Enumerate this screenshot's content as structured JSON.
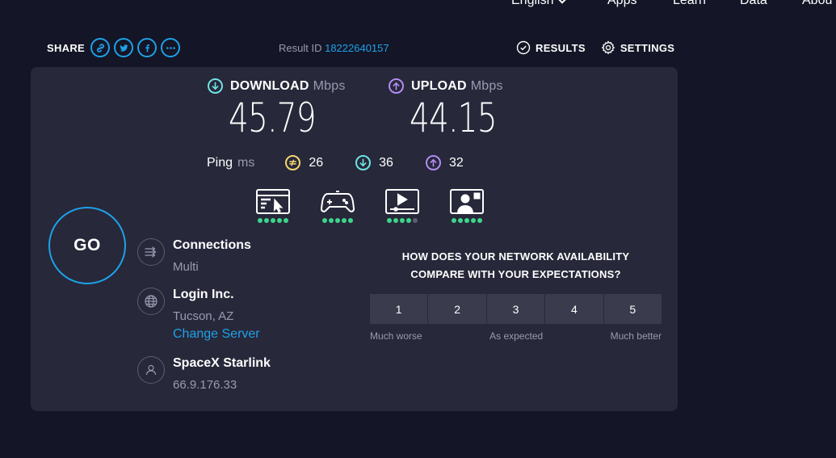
{
  "nav": {
    "english": "English",
    "apps": "Apps",
    "learn": "Learn",
    "data": "Data",
    "about": "Abou"
  },
  "share": {
    "label": "SHARE",
    "icons": [
      "link-icon",
      "twitter-icon",
      "facebook-icon",
      "more-icon"
    ]
  },
  "result": {
    "label": "Result ID",
    "id": "18222640157"
  },
  "actions": {
    "results": "RESULTS",
    "settings": "SETTINGS"
  },
  "download": {
    "label": "DOWNLOAD",
    "unit": "Mbps",
    "value": "45.79",
    "color": "#6fe3e3"
  },
  "upload": {
    "label": "UPLOAD",
    "unit": "Mbps",
    "value": "44.15",
    "color": "#b28cf2"
  },
  "ping": {
    "label": "Ping",
    "unit": "ms",
    "idle": "26",
    "download": "36",
    "upload": "32",
    "idle_color": "#f5d76e",
    "download_color": "#6fe3e3",
    "upload_color": "#b28cf2"
  },
  "apps": [
    {
      "name": "web-browsing",
      "rating": 5
    },
    {
      "name": "gaming",
      "rating": 5
    },
    {
      "name": "video-streaming",
      "rating": 4
    },
    {
      "name": "video-chat",
      "rating": 5
    }
  ],
  "go": {
    "label": "GO"
  },
  "connections": {
    "title": "Connections",
    "value": "Multi"
  },
  "server": {
    "title": "Login Inc.",
    "location": "Tucson, AZ",
    "change": "Change Server"
  },
  "isp": {
    "title": "SpaceX Starlink",
    "ip": "66.9.176.33"
  },
  "survey": {
    "question_line1": "HOW DOES YOUR NETWORK AVAILABILITY",
    "question_line2": "COMPARE WITH YOUR EXPECTATIONS?",
    "options": [
      "1",
      "2",
      "3",
      "4",
      "5"
    ],
    "low": "Much worse",
    "mid": "As expected",
    "high": "Much better"
  },
  "colors": {
    "accent": "#1ea1e8",
    "good": "#3dd68c",
    "card": "#27283a",
    "background": "#141526"
  }
}
